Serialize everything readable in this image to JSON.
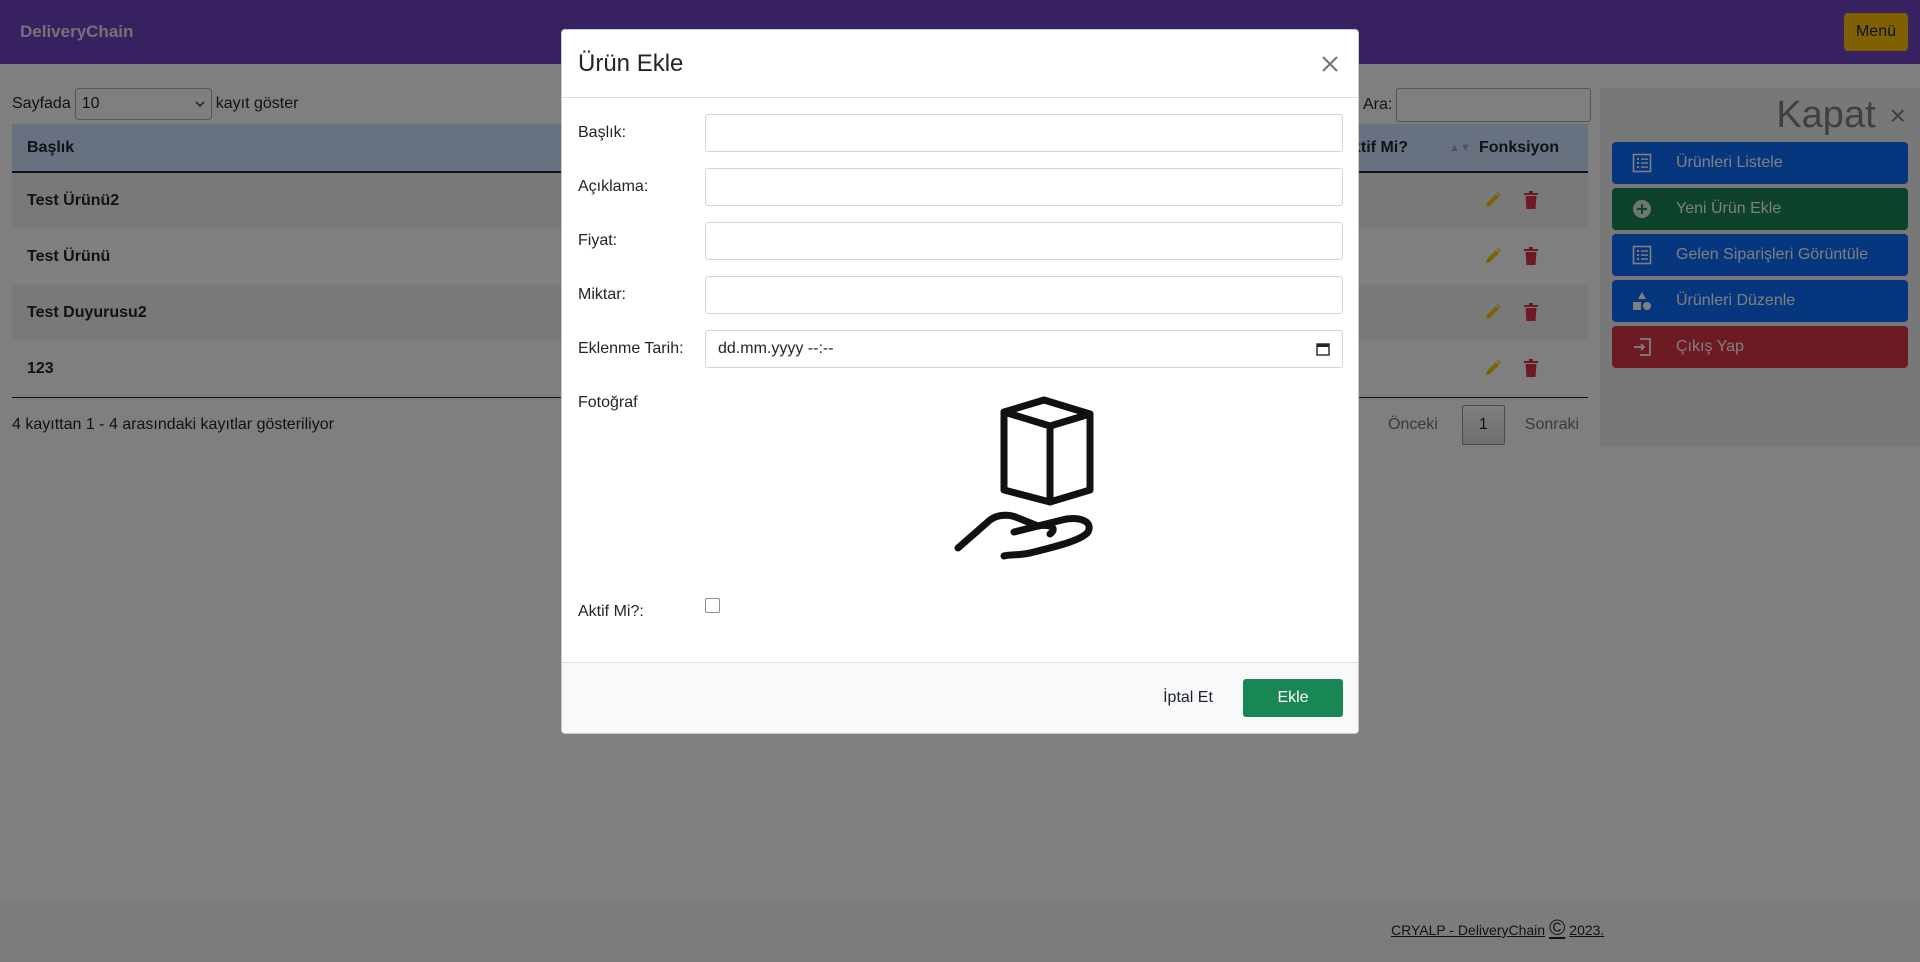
{
  "navbar": {
    "brand": "DeliveryChain",
    "menu_label": "Menü"
  },
  "table_controls": {
    "length_prefix": "Sayfada",
    "length_value": "10",
    "length_suffix": "kayıt göster",
    "search_label": "Ara:",
    "search_value": ""
  },
  "table": {
    "columns": {
      "title": "Başlık",
      "active": "ktif Mi?",
      "functions": "Fonksiyon"
    },
    "rows": [
      {
        "title": "Test Ürünü2"
      },
      {
        "title": "Test Ürünü"
      },
      {
        "title": "Test Duyurusu2"
      },
      {
        "title": "123"
      }
    ],
    "info": "4 kayıttan 1 - 4 arasındaki kayıtlar gösteriliyor",
    "pagination": {
      "prev": "Önceki",
      "current": "1",
      "next": "Sonraki"
    }
  },
  "sidepanel": {
    "close_text": "Kapat",
    "close_icon": "×",
    "items": [
      {
        "label": "Ürünleri Listele",
        "icon": "list-icon",
        "color": "#0d6efd"
      },
      {
        "label": "Yeni Ürün Ekle",
        "icon": "plus-circle-icon",
        "color": "#198754"
      },
      {
        "label": "Gelen Siparişleri Görüntüle",
        "icon": "list-icon",
        "color": "#0d6efd"
      },
      {
        "label": "Ürünleri Düzenle",
        "icon": "shapes-icon",
        "color": "#0d6efd"
      },
      {
        "label": "Çıkış Yap",
        "icon": "exit-icon",
        "color": "#dc3545"
      }
    ]
  },
  "modal": {
    "title": "Ürün Ekle",
    "fields": {
      "title_label": "Başlık:",
      "title_value": "",
      "description_label": "Açıklama:",
      "description_value": "",
      "price_label": "Fiyat:",
      "price_value": "",
      "quantity_label": "Miktar:",
      "quantity_value": "",
      "date_label": "Eklenme Tarih:",
      "date_value": "dd.mm.yyyy --:--",
      "photo_label": "Fotoğraf",
      "photo_icon": "box-in-hand-icon",
      "active_label": "Aktif Mi?:",
      "active_checked": false
    },
    "cancel_label": "İptal Et",
    "add_label": "Ekle"
  },
  "footer": {
    "text": "CRYALP - DeliveryChain",
    "copyright_symbol": "©",
    "year": "2023."
  },
  "colors": {
    "navbar": "#6f42c1",
    "menu_button": "#ffc107",
    "table_header": "#cfe2ff",
    "edit_icon": "#ffc107",
    "delete_icon": "#dc3545",
    "primary": "#0d6efd",
    "success": "#198754",
    "danger": "#dc3545"
  }
}
